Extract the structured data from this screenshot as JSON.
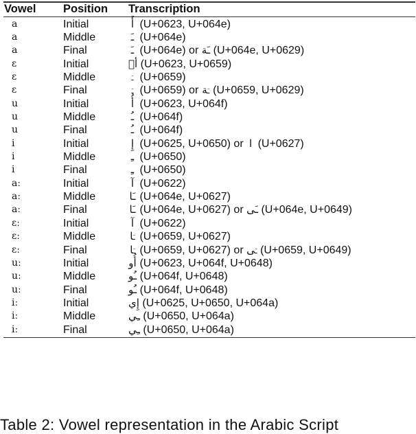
{
  "table": {
    "headers": {
      "vowel": "Vowel",
      "position": "Position",
      "transcription": "Transcription"
    },
    "rows": [
      {
        "vowel": "a",
        "position": "Initial",
        "glyph": "أَ",
        "codes": "(U+0623, U+064e)"
      },
      {
        "vowel": "a",
        "position": "Middle",
        "glyph": "ـَ",
        "codes": "(U+064e)"
      },
      {
        "vowel": "a",
        "position": "Final",
        "glyph": "ـَ",
        "codes": "(U+064e) or ",
        "glyph2": "ـَة",
        "codes2": "(U+064e, U+0629)"
      },
      {
        "vowel": "ɛ",
        "position": "Initial",
        "glyph": "أٙ",
        "codes": "(U+0623, U+0659)"
      },
      {
        "vowel": "ɛ",
        "position": "Middle",
        "glyph": "ـٙ",
        "codes": "(U+0659)"
      },
      {
        "vowel": "ɛ",
        "position": "Final",
        "glyph": "ـٙ",
        "codes": "(U+0659) or ",
        "glyph2": "ـٙة",
        "codes2": "(U+0659, U+0629)"
      },
      {
        "vowel": "u",
        "position": "Initial",
        "glyph": "أُ",
        "codes": "(U+0623, U+064f)"
      },
      {
        "vowel": "u",
        "position": "Middle",
        "glyph": "ـُ",
        "codes": "(U+064f)"
      },
      {
        "vowel": "u",
        "position": "Final",
        "glyph": "ـُ",
        "codes": "(U+064f)"
      },
      {
        "vowel": "i",
        "position": "Initial",
        "glyph": "إِ",
        "codes": "(U+0625, U+0650) or ",
        "glyph2": "ا",
        "codes2": "(U+0627)"
      },
      {
        "vowel": "i",
        "position": "Middle",
        "glyph": "ـِ",
        "codes": "(U+0650)"
      },
      {
        "vowel": "i",
        "position": "Final",
        "glyph": "ـِ",
        "codes": "(U+0650)"
      },
      {
        "vowel": "aː",
        "position": "Initial",
        "glyph": "آ",
        "codes": "(U+0622)"
      },
      {
        "vowel": "aː",
        "position": "Middle",
        "glyph": "ـَا",
        "codes": "(U+064e, U+0627)"
      },
      {
        "vowel": "aː",
        "position": "Final",
        "glyph": "ـَا",
        "codes": "(U+064e, U+0627) or ",
        "glyph2": "ـَى",
        "codes2": "(U+064e, U+0649)"
      },
      {
        "vowel": "ɛː",
        "position": "Initial",
        "glyph": "آ",
        "codes": "(U+0622)"
      },
      {
        "vowel": "ɛː",
        "position": "Middle",
        "glyph": "ـٙا",
        "codes": "(U+0659, U+0627)"
      },
      {
        "vowel": "ɛː",
        "position": "Final",
        "glyph": "ـٙا",
        "codes": "(U+0659, U+0627) or ",
        "glyph2": "ـٙى",
        "codes2": "(U+0659, U+0649)"
      },
      {
        "vowel": "uː",
        "position": "Initial",
        "glyph": "أُو",
        "codes": "(U+0623, U+064f, U+0648)"
      },
      {
        "vowel": "uː",
        "position": "Middle",
        "glyph": "ـُو",
        "codes": "(U+064f, U+0648)"
      },
      {
        "vowel": "uː",
        "position": "Final",
        "glyph": "ـُو",
        "codes": "(U+064f, U+0648)"
      },
      {
        "vowel": "iː",
        "position": "Initial",
        "glyph": "إِي",
        "codes": "(U+0625, U+0650, U+064a)"
      },
      {
        "vowel": "iː",
        "position": "Middle",
        "glyph": "ـِي",
        "codes": "(U+0650, U+064a)"
      },
      {
        "vowel": "iː",
        "position": "Final",
        "glyph": "ـِي",
        "codes": "(U+0650, U+064a)"
      }
    ]
  },
  "caption": "Table 2:  Vowel representation in the Arabic Script"
}
